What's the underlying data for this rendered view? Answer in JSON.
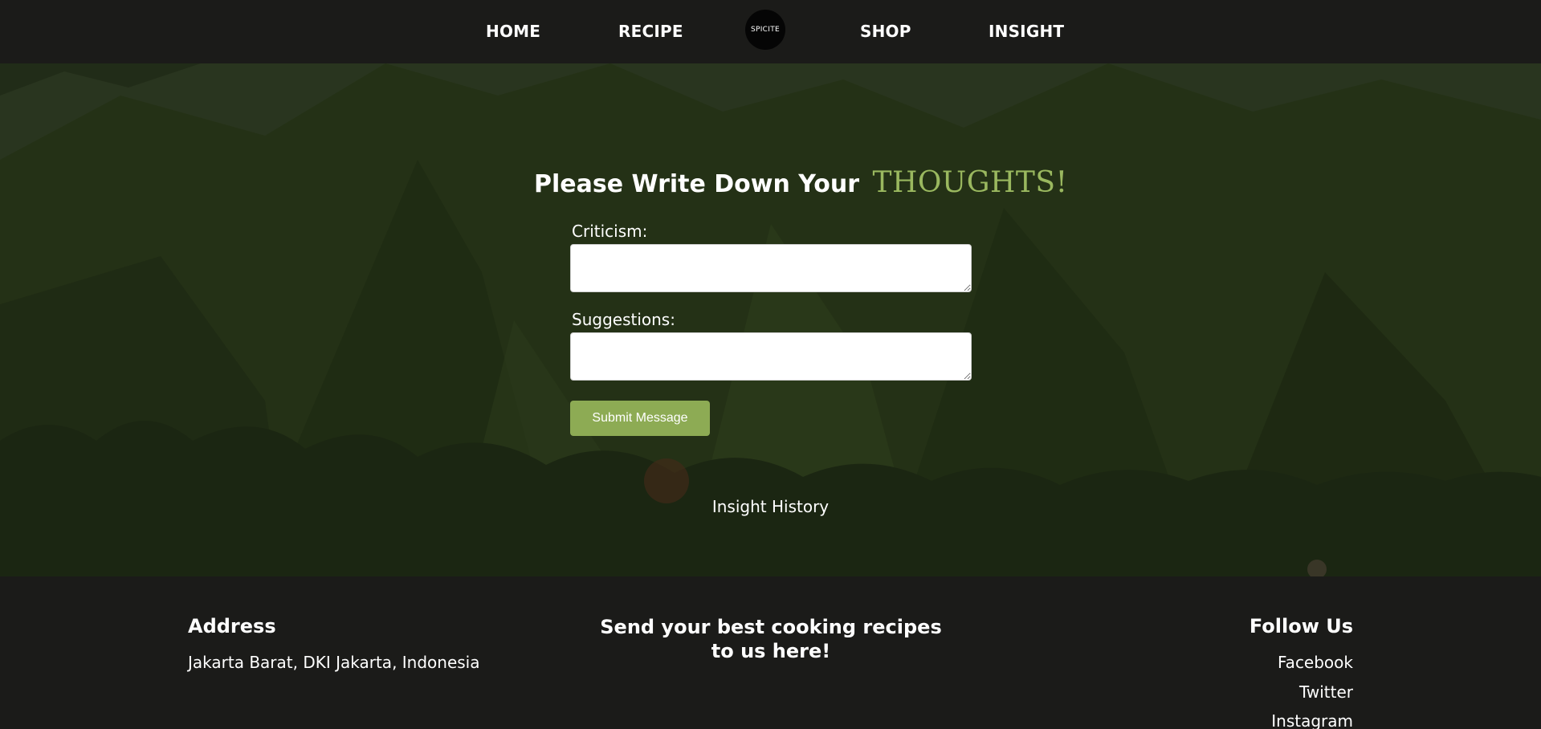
{
  "nav": {
    "home": "HOME",
    "recipe": "RECIPE",
    "logo": "SPICITE",
    "shop": "SHOP",
    "insight": "INSIGHT"
  },
  "form": {
    "heading": "Please Write Down Your",
    "heading_accent": "THOUGHTS!",
    "criticism_label": "Criticism:",
    "criticism_value": "",
    "suggestions_label": "Suggestions:",
    "suggestions_value": "",
    "submit_label": "Submit Message"
  },
  "history_link": "Insight History",
  "footer": {
    "address_title": "Address",
    "address_text": "Jakarta Barat, DKI Jakarta, Indonesia",
    "send_text": "Send your best cooking recipes to us here!",
    "follow_title": "Follow Us",
    "social": [
      "Facebook",
      "Twitter",
      "Instagram"
    ]
  },
  "colors": {
    "background": "#1b1b19",
    "accent": "#9ab85f",
    "button": "#8dab54",
    "text": "#ffffff"
  }
}
